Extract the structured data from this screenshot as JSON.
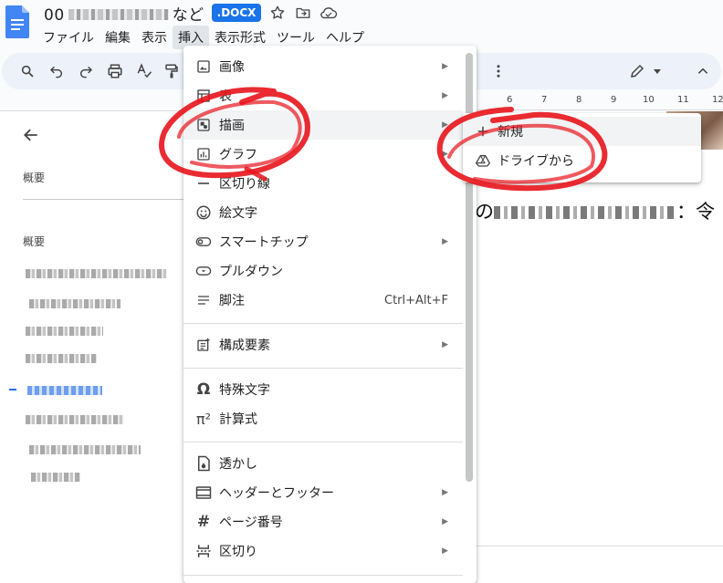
{
  "header": {
    "title_start": "00",
    "title_end": "など",
    "format_badge": ".DOCX"
  },
  "menubar": [
    {
      "label": "ファイル"
    },
    {
      "label": "編集"
    },
    {
      "label": "表示"
    },
    {
      "label": "挿入",
      "active": true
    },
    {
      "label": "表示形式"
    },
    {
      "label": "ツール"
    },
    {
      "label": "ヘルプ"
    }
  ],
  "outline": {
    "section1": "概要",
    "section2": "概要"
  },
  "ruler": [
    "6",
    "7",
    "8",
    "9",
    "10",
    "11",
    "12"
  ],
  "page": {
    "text_start": "の",
    "text_end": "：令"
  },
  "insert_menu": {
    "items": [
      {
        "label": "画像",
        "icon": "image-icon",
        "submenu": true
      },
      {
        "label": "表",
        "icon": "table-icon",
        "submenu": true
      },
      {
        "label": "描画",
        "icon": "drawing-icon",
        "submenu": true,
        "hover": true
      },
      {
        "label": "グラフ",
        "icon": "chart-icon",
        "submenu": true
      },
      {
        "label": "区切り線",
        "icon": "horizontal-line-icon"
      },
      {
        "label": "絵文字",
        "icon": "emoji-icon"
      },
      {
        "label": "スマートチップ",
        "icon": "smart-chip-icon",
        "submenu": true
      },
      {
        "label": "プルダウン",
        "icon": "dropdown-icon"
      },
      {
        "label": "脚注",
        "icon": "footnote-icon",
        "shortcut": "Ctrl+Alt+F"
      },
      {
        "label": "構成要素",
        "icon": "building-blocks-icon",
        "submenu": true
      },
      {
        "label": "特殊文字",
        "icon": "omega-icon"
      },
      {
        "label": "計算式",
        "icon": "pi-icon"
      },
      {
        "label": "透かし",
        "icon": "watermark-icon"
      },
      {
        "label": "ヘッダーとフッター",
        "icon": "header-footer-icon",
        "submenu": true
      },
      {
        "label": "ページ番号",
        "icon": "page-number-icon",
        "submenu": true
      },
      {
        "label": "区切り",
        "icon": "break-icon",
        "submenu": true
      }
    ]
  },
  "drawing_submenu": {
    "items": [
      {
        "label": "新規",
        "icon": "plus-icon"
      },
      {
        "label": "ドライブから",
        "icon": "drive-icon"
      }
    ]
  },
  "colors": {
    "accent": "#1a73e8",
    "annotation": "#e8141c",
    "menu_hover": "#f1f3f4"
  }
}
